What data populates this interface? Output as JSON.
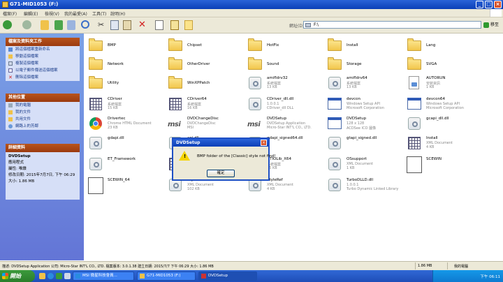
{
  "window": {
    "title": "G71-MID1053 (F:)"
  },
  "menu": [
    "檔案(F)",
    "編輯(E)",
    "檢視(V)",
    "我的最愛(A)",
    "工具(T)",
    "說明(H)"
  ],
  "address": {
    "label": "網址(D)",
    "value": "F:\\",
    "go": "移至"
  },
  "tasks": {
    "title": "檔案及資料夾工作",
    "items": [
      "將這個檔案重新命名",
      "移動這個檔案",
      "複製這個檔案",
      "以電子郵件傳送這個檔案",
      "刪除這個檔案"
    ]
  },
  "places": {
    "title": "其他位置",
    "items": [
      "我的電腦",
      "我的文件",
      "共用文件",
      "網路上的芳鄰"
    ]
  },
  "details": {
    "title": "詳細資料",
    "name": "DVDSetup",
    "type": "應用程式",
    "attr": "屬性: 唯讀",
    "modified": "修改日期: 2015年7月7日, 下午 06:29",
    "size": "大小: 1.86 MB"
  },
  "files": [
    {
      "name": "BMP",
      "icon": "folder",
      "s1": "",
      "s2": ""
    },
    {
      "name": "Chipset",
      "icon": "folder",
      "s1": "",
      "s2": ""
    },
    {
      "name": "HotFix",
      "icon": "folder",
      "s1": "",
      "s2": ""
    },
    {
      "name": "Install",
      "icon": "folder",
      "s1": "",
      "s2": ""
    },
    {
      "name": "Lang",
      "icon": "folder",
      "s1": "",
      "s2": ""
    },
    {
      "name": "Network",
      "icon": "folder",
      "s1": "",
      "s2": ""
    },
    {
      "name": "OtherDriver",
      "icon": "folder",
      "s1": "",
      "s2": ""
    },
    {
      "name": "Sound",
      "icon": "folder",
      "s1": "",
      "s2": ""
    },
    {
      "name": "Storage",
      "icon": "folder",
      "s1": "",
      "s2": ""
    },
    {
      "name": "SVGA",
      "icon": "folder",
      "s1": "",
      "s2": ""
    },
    {
      "name": "Utility",
      "icon": "folder",
      "s1": "",
      "s2": ""
    },
    {
      "name": "WinXPPatch",
      "icon": "folder",
      "s1": "",
      "s2": ""
    },
    {
      "name": "amifldrv32",
      "icon": "gear",
      "s1": "系統檔案",
      "s2": "13 KB"
    },
    {
      "name": "amifldrv64",
      "icon": "gear",
      "s1": "系統檔案",
      "s2": "13 KB"
    },
    {
      "name": "AUTORUN",
      "icon": "ini",
      "s1": "安裝資訊",
      "s2": "1 KB"
    },
    {
      "name": "CDriver",
      "icon": "grid",
      "s1": "系統檔案",
      "s2": "15 KB"
    },
    {
      "name": "CDriver64",
      "icon": "grid",
      "s1": "系統檔案",
      "s2": "16 KB"
    },
    {
      "name": "CDriver_dll.dll",
      "icon": "gear",
      "s1": "1.0.0.1",
      "s2": "CDriver_dll DLL"
    },
    {
      "name": "devcon",
      "icon": "win",
      "s1": "Windows Setup API",
      "s2": "Microsoft Corporation"
    },
    {
      "name": "devcon64",
      "icon": "win",
      "s1": "Windows Setup API",
      "s2": "Microsoft Corporation"
    },
    {
      "name": "Drivertec",
      "icon": "chrome",
      "s1": "Chrome HTML Document",
      "s2": "23 KB"
    },
    {
      "name": "DVDChangeDisc",
      "icon": "msi",
      "s1": "DVDChangeDisc",
      "s2": "MSI"
    },
    {
      "name": "DVDSetup",
      "icon": "msi",
      "s1": "DVDSetup Application",
      "s2": "Micro-Star INT'L CO., LTD."
    },
    {
      "name": "DVDSetup",
      "icon": "win",
      "s1": "128 x 128",
      "s2": "ACDSee ICO 圖像"
    },
    {
      "name": "gcapi_dll.dll",
      "icon": "gear",
      "s1": "",
      "s2": ""
    },
    {
      "name": "gdapi.dll",
      "icon": "gear",
      "s1": "",
      "s2": ""
    },
    {
      "name": "api.dll",
      "icon": "gear",
      "s1": "",
      "s2": ""
    },
    {
      "name": "gdapi_signed64.dll",
      "icon": "gear",
      "s1": "",
      "s2": ""
    },
    {
      "name": "gtapi_signed.dll",
      "icon": "gear",
      "s1": "",
      "s2": ""
    },
    {
      "name": "Install",
      "icon": "grid",
      "s1": "XML Document",
      "s2": "4 KB"
    },
    {
      "name": "ET_Framework",
      "icon": "gear",
      "s1": "",
      "s2": ""
    },
    {
      "name": "NTIOLib",
      "icon": "grid",
      "s1": "系統檔案",
      "s2": "14 KB"
    },
    {
      "name": "NTIOLib_X64",
      "icon": "grid",
      "s1": "系統檔案",
      "s2": "16 KB"
    },
    {
      "name": "OSsupport",
      "icon": "gear",
      "s1": "XML Document",
      "s2": "1 KB"
    },
    {
      "name": "SCEWIN",
      "icon": "blank",
      "s1": "",
      "s2": ""
    },
    {
      "name": "SCEWIN_64",
      "icon": "blank",
      "s1": "",
      "s2": ""
    },
    {
      "name": "Style",
      "icon": "gear",
      "s1": "XML Document",
      "s2": "102 KB"
    },
    {
      "name": "StyleRef",
      "icon": "gear",
      "s1": "XML Document",
      "s2": "4 KB"
    },
    {
      "name": "TurboDLLD.dll",
      "icon": "gear",
      "s1": "1.0.0.1",
      "s2": "Turbo Dynamic Linked Library"
    }
  ],
  "dialog": {
    "title": "DVDSetup",
    "message": "BMP folder of the [Classic] style not find!",
    "ok": "確定"
  },
  "status": {
    "text": "描述: DVDSetup Application 公司: Micro-Star INT'L CO., LTD. 檔案版本: 3.0.1.38 建立日期: 2015/7/7 下午 06:29 大小: 1.86 MB",
    "size": "1.86 MB",
    "location": "我的電腦"
  },
  "taskbar": {
    "start": "開始",
    "items": [
      "MSI 微星科技會員...",
      "G71-MID1053 (F:)",
      "DVDSetup"
    ],
    "clock": "下午 06:11"
  }
}
